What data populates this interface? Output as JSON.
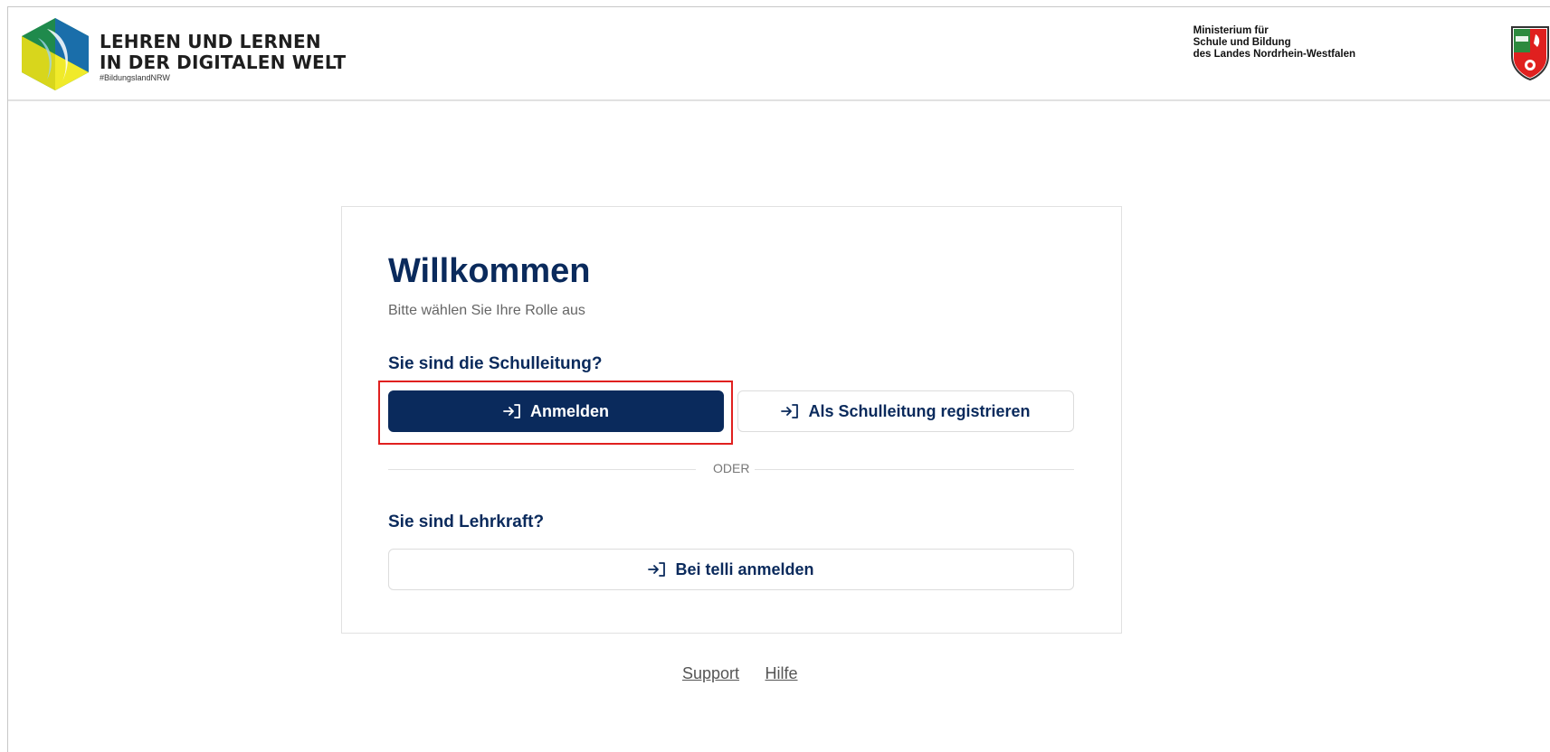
{
  "header": {
    "logo_line1": "LEHREN UND LERNEN",
    "logo_line2": "IN DER DIGITALEN WELT",
    "logo_tag": "#BildungslandNRW",
    "ministry_line1": "Ministerium für",
    "ministry_line2": "Schule und Bildung",
    "ministry_line3": "des Landes Nordrhein-Westfalen",
    "logo_icon": "hexagon-logo-icon",
    "crest_icon": "nrw-crest-icon"
  },
  "card": {
    "title": "Willkommen",
    "subtitle": "Bitte wählen Sie Ihre Rolle aus",
    "principal_section": {
      "label": "Sie sind die Schulleitung?",
      "login_button": "Anmelden",
      "register_button": "Als Schulleitung registrieren"
    },
    "divider_label": "ODER",
    "teacher_section": {
      "label": "Sie sind Lehrkraft?",
      "login_button": "Bei telli anmelden"
    },
    "button_icon": "login-arrow-icon"
  },
  "footer": {
    "support": "Support",
    "help": "Hilfe"
  },
  "colors": {
    "primary": "#0a2a5c",
    "highlight": "#e0201f",
    "border": "#e1e1e1"
  }
}
